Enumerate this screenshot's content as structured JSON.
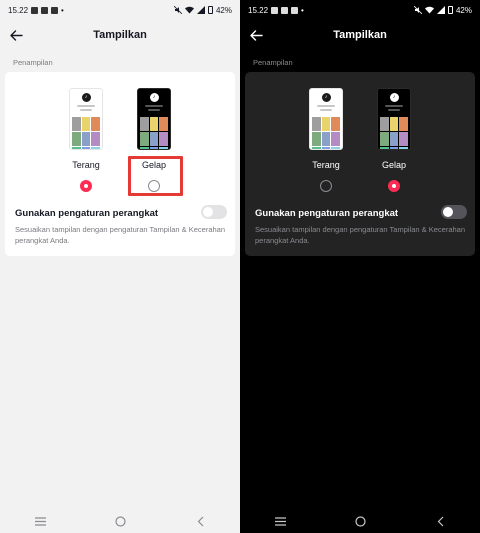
{
  "colors": {
    "accent": "#fe2c55",
    "highlight_box": "#e53935"
  },
  "status": {
    "time": "15.22",
    "battery": "42%"
  },
  "header": {
    "title": "Tampilkan"
  },
  "section": {
    "label": "Penampilan"
  },
  "options": {
    "light": {
      "label": "Terang"
    },
    "dark": {
      "label": "Gelap"
    }
  },
  "device_setting": {
    "title": "Gunakan pengaturan perangkat",
    "description": "Sesuaikan tampilan dengan pengaturan Tampilan & Kecerahan perangkat Anda.",
    "enabled": false
  },
  "panels": [
    {
      "theme": "light",
      "selected": "Terang",
      "annotation": "red box around Gelap option"
    },
    {
      "theme": "dark",
      "selected": "Gelap"
    }
  ]
}
